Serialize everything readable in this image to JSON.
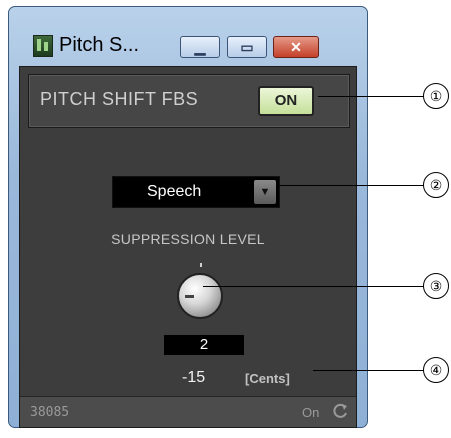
{
  "window": {
    "title": "Pitch S...",
    "buttons": {
      "minimize": "▁",
      "maximize": "▭",
      "close": "✕"
    }
  },
  "header": {
    "title": "PITCH SHIFT FBS",
    "on_button": "ON"
  },
  "mode": {
    "selected": "Speech",
    "arrow": "▼"
  },
  "suppression": {
    "label": "SUPPRESSION LEVEL",
    "value": "2"
  },
  "cents": {
    "value": "-15",
    "unit": "[Cents]"
  },
  "status": {
    "id": "38085",
    "online": "On"
  },
  "callouts": [
    "①",
    "②",
    "③",
    "④"
  ],
  "icons": {
    "app": "app-icon",
    "refresh": "refresh-icon",
    "dropdown_arrow": "chevron-down-icon"
  },
  "colors": {
    "panel_bg": "#3d3d3d",
    "on_button": "#d8ecb5",
    "window_frame": "#9ab8da",
    "close_button": "#c4402a"
  }
}
